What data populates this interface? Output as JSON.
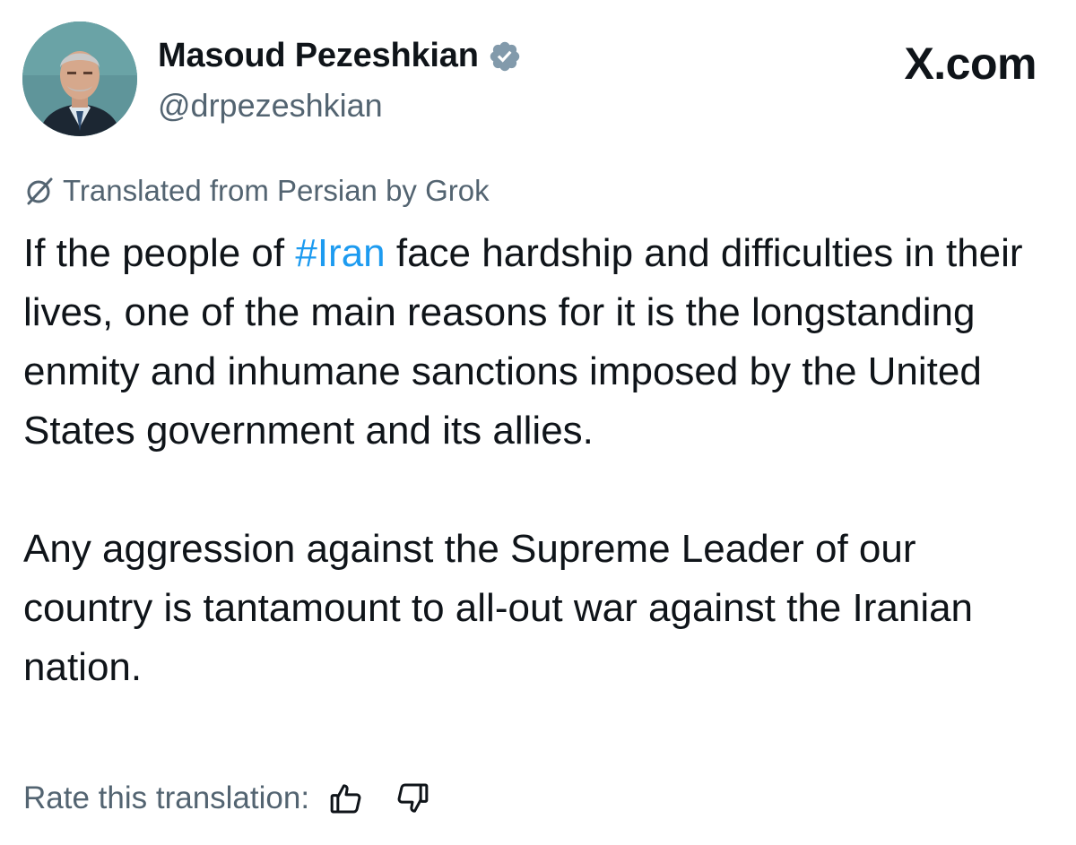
{
  "user": {
    "display_name": "Masoud Pezeshkian",
    "handle": "@drpezeshkian",
    "verified": true,
    "verified_color": "#829aab"
  },
  "brand": {
    "label": "X.com"
  },
  "translation": {
    "notice": "Translated from Persian by Grok",
    "icon": "grok-icon"
  },
  "tweet": {
    "p1_before": "If the people of ",
    "hashtag": "#Iran",
    "p1_after": " face hardship and difficulties in their lives, one of the main reasons for it is the longstanding enmity and inhumane sanctions imposed by the United States government and its allies.",
    "p2": "Any aggression against the Supreme Leader of our country is tantamount to all-out war against the Iranian nation."
  },
  "rating": {
    "label": "Rate this translation:",
    "up_icon": "thumbs-up-icon",
    "down_icon": "thumbs-down-icon"
  },
  "colors": {
    "text": "#0f1419",
    "secondary": "#536471",
    "link": "#1d9bf0"
  }
}
